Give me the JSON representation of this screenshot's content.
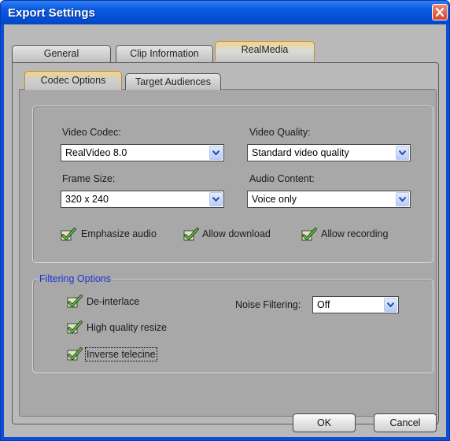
{
  "window": {
    "title": "Export Settings"
  },
  "tabs": [
    "General",
    "Clip Information",
    "RealMedia"
  ],
  "subtabs": [
    "Codec Options",
    "Target Audiences"
  ],
  "codec": {
    "video_codec_label": "Video Codec:",
    "video_codec_value": "RealVideo 8.0",
    "video_quality_label": "Video Quality:",
    "video_quality_value": "Standard video quality",
    "frame_size_label": "Frame Size:",
    "frame_size_value": "320 x 240",
    "audio_content_label": "Audio Content:",
    "audio_content_value": "Voice only",
    "checkboxes": {
      "emphasize_audio": "Emphasize audio",
      "allow_download": "Allow download",
      "allow_recording": "Allow recording"
    }
  },
  "filtering": {
    "legend": "Filtering Options",
    "deinterlace": "De-interlace",
    "high_quality_resize": "High quality resize",
    "inverse_telecine": "Inverse telecine",
    "noise_filtering_label": "Noise Filtering:",
    "noise_filtering_value": "Off"
  },
  "buttons": {
    "ok": "OK",
    "cancel": "Cancel"
  },
  "colors": {
    "titlebar": "#0550d8",
    "legend": "#1a37d6",
    "active_tab_accent": "#f3d489"
  }
}
